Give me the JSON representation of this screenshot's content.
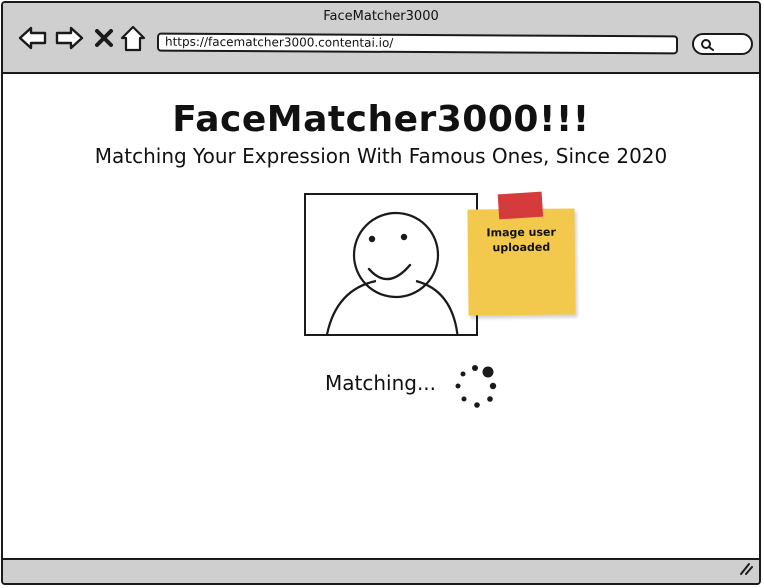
{
  "window": {
    "title": "FaceMatcher3000"
  },
  "toolbar": {
    "back_icon": "arrow-left-icon",
    "forward_icon": "arrow-right-icon",
    "close_icon": "x-icon",
    "home_icon": "home-icon",
    "url": "https://facematcher3000.contentai.io/",
    "search_icon": "search-icon"
  },
  "main": {
    "heading": "FaceMatcher3000!!!",
    "subheading": "Matching Your Expression With Famous Ones, Since 2020",
    "image_icon": "smiley-person-icon",
    "sticky_note": "Image user uploaded",
    "status": "Matching...",
    "spinner_icon": "loading-spinner-icon"
  },
  "colors": {
    "chrome": "#cfcfcf",
    "sticky": "#f2c94c",
    "tape": "#d63b3b",
    "ink": "#1a1a1a"
  }
}
